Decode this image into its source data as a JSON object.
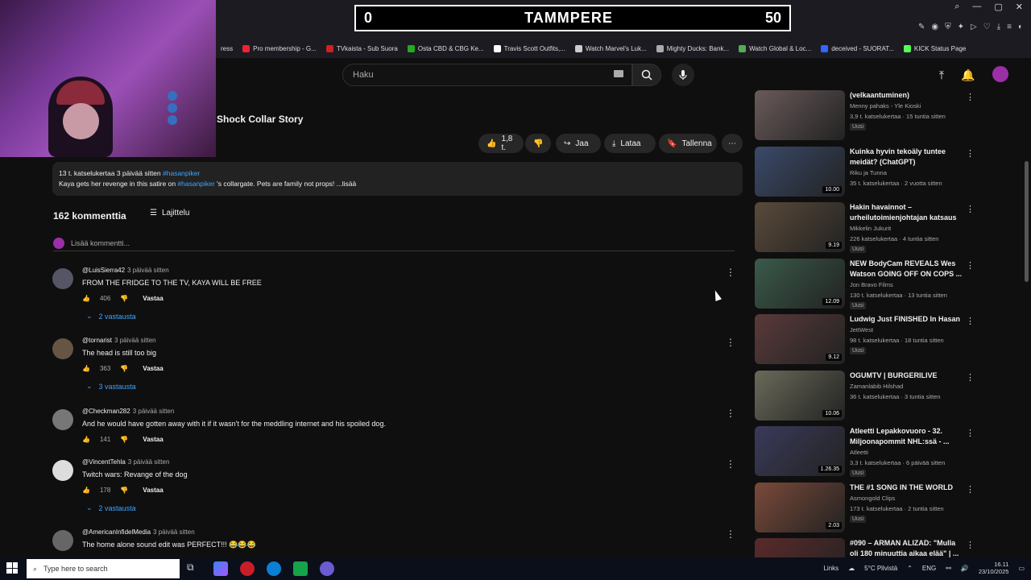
{
  "score": {
    "left": "0",
    "center": "TAMMPERE",
    "right": "50"
  },
  "bookmarks": [
    {
      "label": "ress",
      "color": "#888"
    },
    {
      "label": "Pro membership - G...",
      "color": "#e23"
    },
    {
      "label": "TVkaista - Sub Suora",
      "color": "#c22"
    },
    {
      "label": "Osta CBD & CBG Ke...",
      "color": "#2a2"
    },
    {
      "label": "Travis Scott Outfits,...",
      "color": "#fff"
    },
    {
      "label": "Watch Marvel's Luk...",
      "color": "#ccc"
    },
    {
      "label": "Mighty Ducks: Bank...",
      "color": "#aaa"
    },
    {
      "label": "Watch Global & Loc...",
      "color": "#5a5"
    },
    {
      "label": "deceived - SUORAT...",
      "color": "#36f"
    },
    {
      "label": "KICK Status Page",
      "color": "#5f5"
    }
  ],
  "search": {
    "placeholder": "Haku"
  },
  "video": {
    "title": "Shock Collar Story",
    "likes": "1,8 t.",
    "share": "Jaa",
    "download": "Lataa",
    "save": "Tallenna"
  },
  "description": {
    "meta": "13 t. katselukertaa  3 päivää sitten",
    "tag": "#hasanpiker",
    "text_pre": "Kaya gets her revenge in this satire on ",
    "text_tag": "#hasanpiker",
    "text_post": " 's collargate. Pets are family not props! ...lisää"
  },
  "comments_header": {
    "count": "162 kommenttia",
    "sort": "Lajittelu",
    "add": "Lisää kommentti..."
  },
  "comments": [
    {
      "user": "@LuisSierra42",
      "time": "3 päivää sitten",
      "text": "FROM THE FRIDGE TO THE TV, KAYA WILL BE FREE",
      "likes": "406",
      "reply": "Vastaa",
      "replies": "2 vastausta",
      "avatar": "#556"
    },
    {
      "user": "@tornarist",
      "time": "3 päivää sitten",
      "text": "The head is still too big",
      "likes": "363",
      "reply": "Vastaa",
      "replies": "3 vastausta",
      "avatar": "#654"
    },
    {
      "user": "@Checkman282",
      "time": "3 päivää sitten",
      "text": "And he would have gotten away with it if it wasn't for the meddling internet and his spoiled dog.",
      "likes": "141",
      "reply": "Vastaa",
      "replies": "",
      "avatar": "#777"
    },
    {
      "user": "@VincentTehla",
      "time": "3 päivää sitten",
      "text": "Twitch wars: Revange of the dog",
      "likes": "178",
      "reply": "Vastaa",
      "replies": "2 vastausta",
      "avatar": "#ddd"
    },
    {
      "user": "@AmericanInfidelMedia",
      "time": "3 päivää sitten",
      "text": "The home alone sound edit was PERFECT!!! 😂😂😂",
      "likes": "",
      "reply": "",
      "replies": "",
      "avatar": "#666"
    }
  ],
  "recommendations": [
    {
      "title": "(velkaantuminen)",
      "channel": "Menny pahaks - Yle Kioski",
      "stats": "3,9 t. katselukertaa · 15 tuntia sitten",
      "badge": "Uusi",
      "duration": "",
      "thumb": "#6a5a5a"
    },
    {
      "title": "Kuinka hyvin tekoäly tuntee meidät? (ChatGPT)",
      "channel": "Riku ja Tunna",
      "stats": "35 t. katselukertaa · 2 vuotta sitten",
      "badge": "",
      "duration": "10.00",
      "thumb": "#3a4a6a"
    },
    {
      "title": "Hakin havainnot – urheilutoimienjohtajan katsaus",
      "channel": "Mikkelin Jukurit",
      "stats": "226 katselukertaa · 4 tuntia sitten",
      "badge": "Uusi",
      "duration": "9.19",
      "thumb": "#5a4a3a"
    },
    {
      "title": "NEW BodyCam REVEALS Wes Watson GOING OFF ON COPS ...",
      "channel": "Jon Bravo Films",
      "stats": "130 t. katselukertaa · 13 tuntia sitten",
      "badge": "Uusi",
      "duration": "12.09",
      "thumb": "#3a5a4a"
    },
    {
      "title": "Ludwig Just FINISHED In Hasan",
      "channel": "JettWest",
      "stats": "98 t. katselukertaa · 18 tuntia sitten",
      "badge": "Uusi",
      "duration": "9.12",
      "thumb": "#5a3a3a"
    },
    {
      "title": "OGUMTV | BURGERILIVE",
      "channel": "Zamanlabib Hilshad",
      "stats": "36 t. katselukertaa · 3 tuntia sitten",
      "badge": "",
      "duration": "10.06",
      "thumb": "#6a6a5a"
    },
    {
      "title": "Atleetti Lepakkovuoro - 32. Miljoonapommit NHL:ssä - ...",
      "channel": "Atleetti",
      "stats": "3,3 t. katselukertaa · 6 päivää sitten",
      "badge": "Uusi",
      "duration": "1.26.35",
      "thumb": "#3a3a5a"
    },
    {
      "title": "THE #1 SONG IN THE WORLD",
      "channel": "Asmongold Clips",
      "stats": "173 t. katselukertaa · 2 tuntia sitten",
      "badge": "Uusi",
      "duration": "2.03",
      "thumb": "#7a4a3a"
    },
    {
      "title": "#090 – ARMAN ALIZAD: \"Mulla oli 180 minuuttia aikaa elää\" | ...",
      "channel": "",
      "stats": "",
      "badge": "",
      "duration": "",
      "thumb": "#5a2a2a"
    }
  ],
  "taskbar": {
    "search": "Type here to search",
    "links": "Links",
    "weather": "5°C  Pilvistä",
    "lang": "ENG",
    "time": "16.11",
    "date": "23/10/2025"
  }
}
